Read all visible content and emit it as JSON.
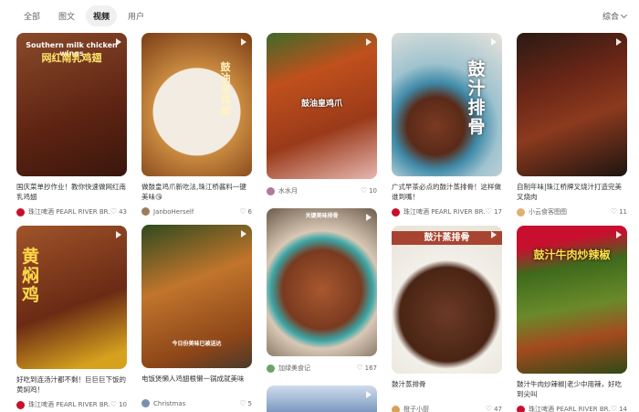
{
  "tabs": [
    "全部",
    "图文",
    "视频",
    "用户"
  ],
  "active_tab": "视频",
  "sort_label": "综合",
  "cards": [
    {
      "overlay": "Southern milk chicken wings",
      "overlay2": "网红南乳鸡翅",
      "title": "国庆菜单抄作业！教你快速做网红南乳鸡翅",
      "author": "珠江啤酒 PEARL RIVER BR...",
      "likes": "43",
      "bg": "#7a3b22"
    },
    {
      "overlay": "鼓油皇鸡脚",
      "overlay2": "",
      "title": "做鼓皇鸡爪新吃法,珠江桥酱料一键美味😘",
      "author": "JanboHerself",
      "likes": "6",
      "bg": "#a5541c"
    },
    {
      "overlay": "鼓油皇鸡爪",
      "overlay2": "",
      "title": "",
      "author": "水水月",
      "likes": "10",
      "bg": "#9a3a1a"
    },
    {
      "overlay": "鼓汁排骨",
      "overlay2": "",
      "title": "广式早茶必点的鼓汁蒸排骨！这样做谁到嘴！",
      "author": "珠江啤酒 PEARL RIVER BR...",
      "likes": "17",
      "bg": "#7fb3c4"
    },
    {
      "overlay": "",
      "overlay2": "",
      "title": "自制年味|珠江桥牌叉烧汁打造完美叉烧肉",
      "author": "小云食客图图",
      "likes": "11",
      "bg": "#5a1f12"
    },
    {
      "overlay": "黄焖鸡",
      "overlay2": "",
      "title": "好吃到连汤汁都不剩！巨巨巨下饭的黄焖鸡！",
      "author": "珠江啤酒 PEARL RIVER BR...",
      "likes": "10",
      "bg": "#6a3418"
    },
    {
      "overlay": "今日份美味已被送达",
      "overlay2": "",
      "title": "电饭煲懒人鸡翅根懒一锅成就美味",
      "author": "Christmas",
      "likes": "5",
      "bg": "#b86a2a"
    },
    {
      "overlay": "关键美味排骨",
      "overlay2": "",
      "title": "",
      "author": "加绿美食记",
      "likes": "167",
      "bg": "#8c4a2e"
    },
    {
      "overlay": "鼓汁蒸排骨",
      "overlay2": "",
      "title": "鼓汁蒸排骨",
      "author": "橙子小厨",
      "likes": "47",
      "bg": "#6b3a26"
    },
    {
      "overlay": "鼓汁牛肉炒辣椒",
      "overlay2": "",
      "title": "鼓汁牛肉炒辣椒|老少中用辣，好吃到尖叫",
      "author": "珠江啤酒 PEARL RIVER BR...",
      "likes": "14",
      "bg": "#4f6a22"
    },
    {
      "overlay": "",
      "overlay2": "",
      "title": "",
      "author": "",
      "likes": "",
      "bg": "#7d9cc6"
    }
  ]
}
